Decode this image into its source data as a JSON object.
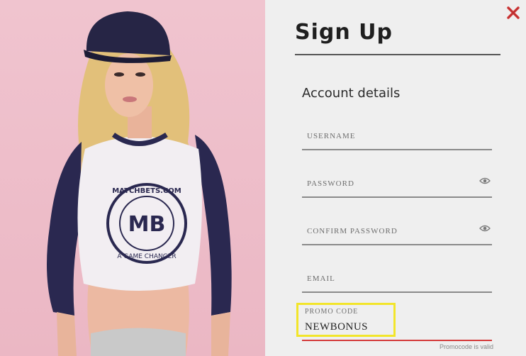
{
  "hero": {
    "shirt_brand": "MATCHBETS.COM",
    "shirt_tagline": "A GAME CHANGER",
    "shirt_monogram": "MB"
  },
  "dialog": {
    "title": "Sign Up",
    "section_title": "Account details",
    "fields": {
      "username": {
        "label": "USERNAME"
      },
      "password": {
        "label": "PASSWORD"
      },
      "confirm_password": {
        "label": "CONFIRM PASSWORD"
      },
      "email": {
        "label": "EMAIL"
      },
      "promo": {
        "label": "PROMO CODE",
        "value": "NEWBONUS",
        "hint": "Promocode is valid"
      }
    }
  },
  "colors": {
    "hero_bg": "#ebb7c4",
    "panel_bg": "#efefef",
    "close": "#d43b3b",
    "promo_highlight": "#f2e52a",
    "promo_underline": "#d43b3b"
  },
  "icons": {
    "close": "close-icon",
    "password_toggle": "eye-icon"
  }
}
